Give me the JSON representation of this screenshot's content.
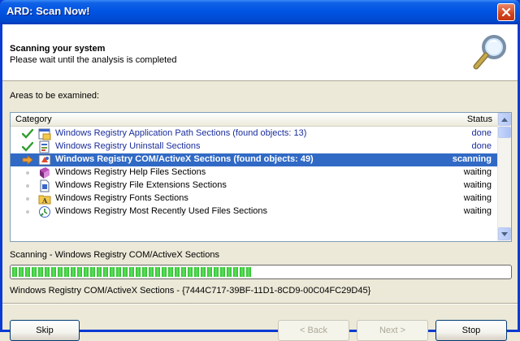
{
  "window": {
    "title": "ARD: Scan Now!"
  },
  "header": {
    "title": "Scanning your system",
    "subtitle": "Please wait until the analysis is completed"
  },
  "areas_label": "Areas to be examined:",
  "list": {
    "columns": {
      "category": "Category",
      "status": "Status"
    },
    "rows": [
      {
        "label": "Windows Registry Application Path Sections (found objects: 13)",
        "status": "done",
        "state": "done",
        "icon": "app-path-icon"
      },
      {
        "label": "Windows Registry Uninstall Sections",
        "status": "done",
        "state": "done",
        "icon": "uninstall-icon"
      },
      {
        "label": "Windows Registry COM/ActiveX Sections (found objects: 49)",
        "status": "scanning",
        "state": "active",
        "icon": "activex-icon"
      },
      {
        "label": "Windows Registry Help Files Sections",
        "status": "waiting",
        "state": "waiting",
        "icon": "help-book-icon"
      },
      {
        "label": "Windows Registry File Extensions Sections",
        "status": "waiting",
        "state": "waiting",
        "icon": "file-extensions-icon"
      },
      {
        "label": "Windows Registry Fonts Sections",
        "status": "waiting",
        "state": "waiting",
        "icon": "fonts-folder-icon"
      },
      {
        "label": "Windows Registry Most Recently Used Files Sections",
        "status": "waiting",
        "state": "waiting",
        "icon": "recent-files-icon"
      }
    ]
  },
  "scan": {
    "current_label": "Scanning - Windows Registry COM/ActiveX Sections",
    "progress_fraction": 0.48,
    "detail": "Windows Registry COM/ActiveX Sections - {7444C717-39BF-11D1-8CD9-00C04FC29D45}"
  },
  "buttons": {
    "skip": "Skip",
    "back": "< Back",
    "next": "Next >",
    "stop": "Stop"
  },
  "colors": {
    "titlebar": "#0054e3",
    "selection": "#316ac5",
    "progress": "#2fbb2f",
    "done_text": "#1a2d9c"
  }
}
